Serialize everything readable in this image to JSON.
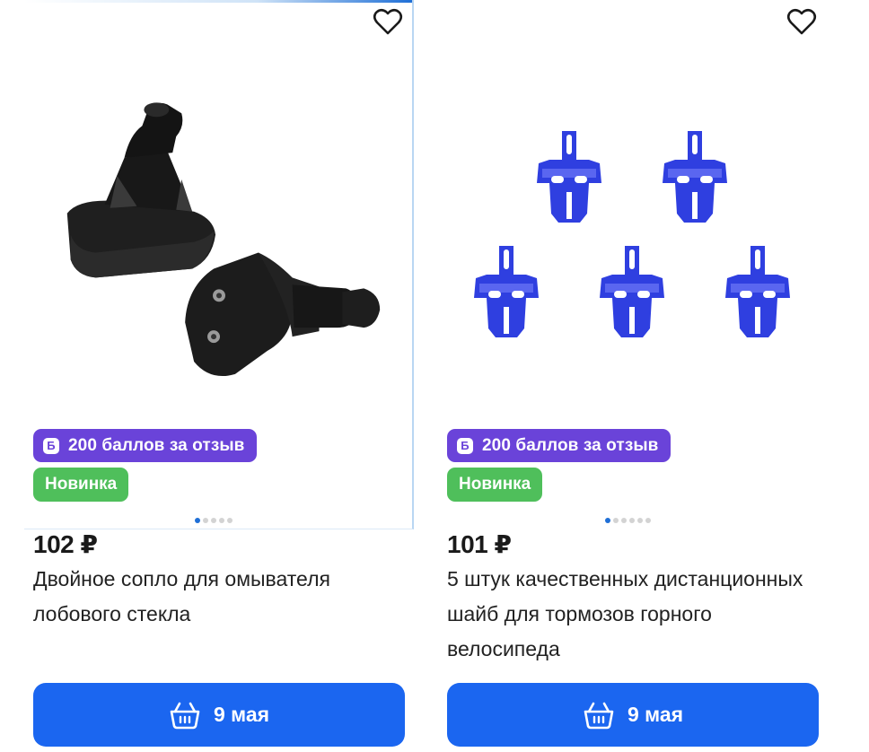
{
  "products": [
    {
      "image": "black-washer-nozzle-image",
      "badge_points": "200 баллов за отзыв",
      "badge_points_icon": "Б",
      "badge_new": "Новинка",
      "price": "102 ₽",
      "title": "Двойное сопло для омывателя лобового стекла",
      "button_label": "9 мая",
      "gallery_dots": 5,
      "active_dot": 0
    },
    {
      "image": "blue-brake-spacers-image",
      "badge_points": "200 баллов за отзыв",
      "badge_points_icon": "Б",
      "badge_new": "Новинка",
      "price": "101 ₽",
      "title": "5 штук качественных дистанционных шайб для тормозов горного велосипеда",
      "button_label": "9 мая",
      "gallery_dots": 6,
      "active_dot": 0
    }
  ],
  "colors": {
    "button": "#1b66f0",
    "points_badge": "#6a43d9",
    "new_badge": "#4fbf5b",
    "spacer_blue": "#2f3fe0"
  },
  "icons": {
    "favorite": "heart-outline-icon",
    "cart": "basket-icon"
  }
}
